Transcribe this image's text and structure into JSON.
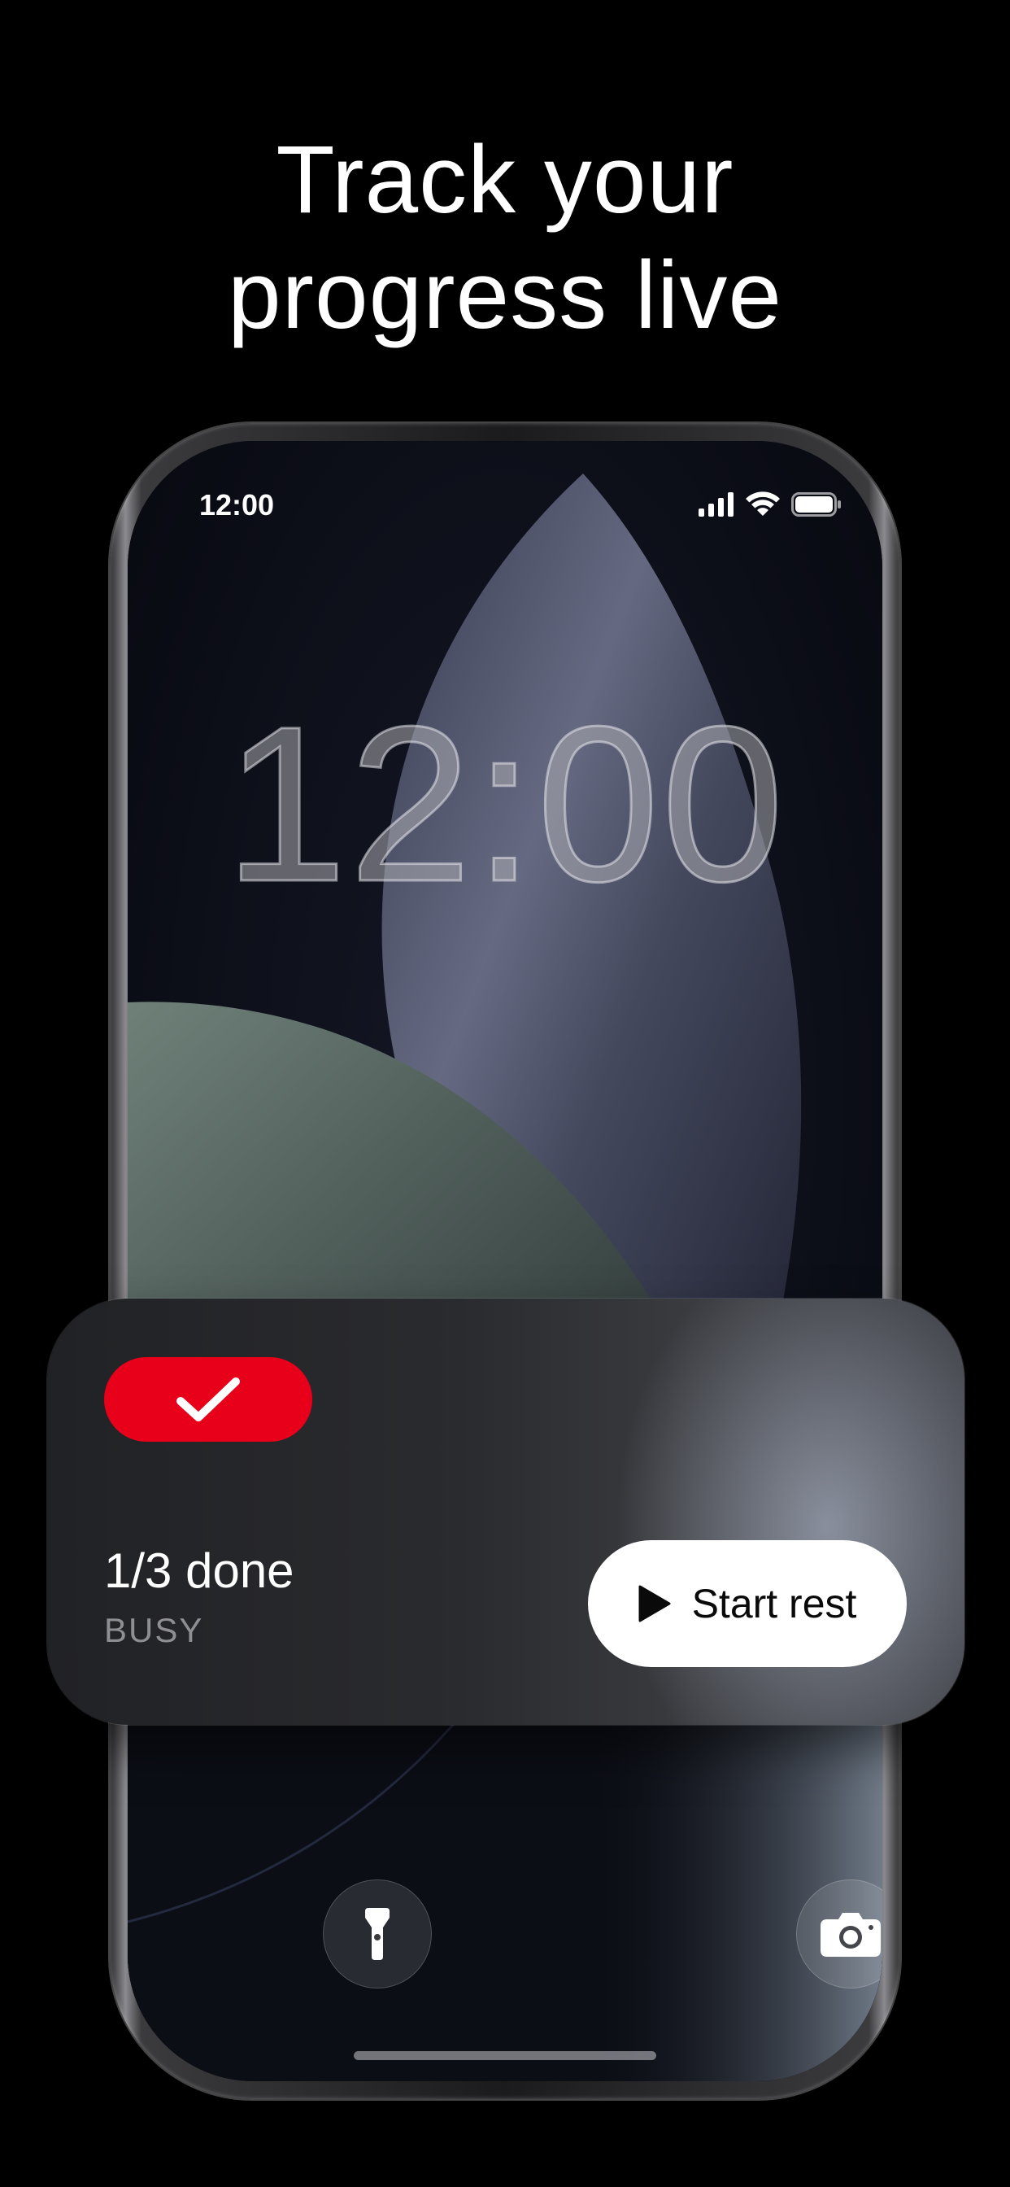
{
  "headline": {
    "line1": "Track your",
    "line2": "progress live"
  },
  "status_bar": {
    "time": "12:00",
    "icons": [
      "cellular-signal-icon",
      "wifi-icon",
      "battery-icon"
    ]
  },
  "lock_screen": {
    "clock": "12:00",
    "left_button_icon": "flashlight-icon",
    "right_button_icon": "camera-icon"
  },
  "live_activity": {
    "badge_icon": "checkmark-icon",
    "progress": "1/3 done",
    "status": "BUSY",
    "action_icon": "play-icon",
    "action_label": "Start rest"
  },
  "colors": {
    "background": "#000000",
    "accent_red": "#e8001b",
    "button_white": "#ffffff",
    "secondary_text": "#8e8e93"
  }
}
